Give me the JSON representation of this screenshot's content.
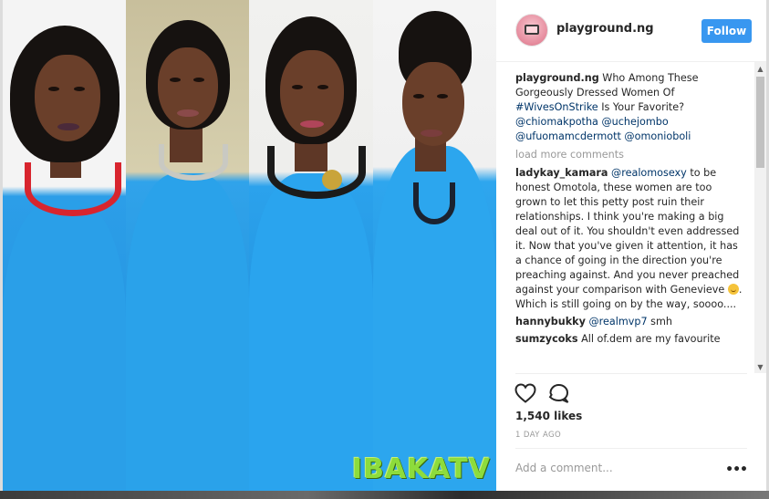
{
  "post": {
    "username": "playground.ng",
    "follow_label": "Follow",
    "caption": {
      "username": "playground.ng",
      "text": "Who Among These Gorgeously Dressed Women Of",
      "hashtag": "#WivesOnStrike",
      "text_after": "Is Your Favorite?",
      "mentions": [
        "@chiomakpotha",
        "@uchejombo",
        "@ufuomamcdermott",
        "@omonioboli"
      ]
    },
    "load_more_label": "load more comments",
    "comments": [
      {
        "username": "ladykay_kamara",
        "mention": "@realomosexy",
        "text": "to be honest Omotola, these women are too grown to let this petty post ruin their relationships. I think you're making a big deal out of it. You shouldn't even addressed it. Now that you've given it attention, it has a chance of going in the direction you're preaching against. And you never preached against your comparison with Genevieve",
        "text_after_emoji": ". Which is still going on by the way, soooo....",
        "emoji": "smile-emoji"
      },
      {
        "username": "hannybukky",
        "mention": "@realmvp7",
        "text": "smh"
      },
      {
        "username": "sumzycoks",
        "mention": "",
        "text": "All of.dem are my favourite"
      }
    ],
    "likes": "1,540 likes",
    "time": "1 DAY AGO",
    "add_comment_placeholder": "Add a comment...",
    "more_label": "•••",
    "watermark": "IBAKATV",
    "colors": {
      "follow_blue": "#3897f0",
      "link": "#003569",
      "dress_blue": "#2a9fe8",
      "watermark_green": "#8ddc3c"
    }
  }
}
